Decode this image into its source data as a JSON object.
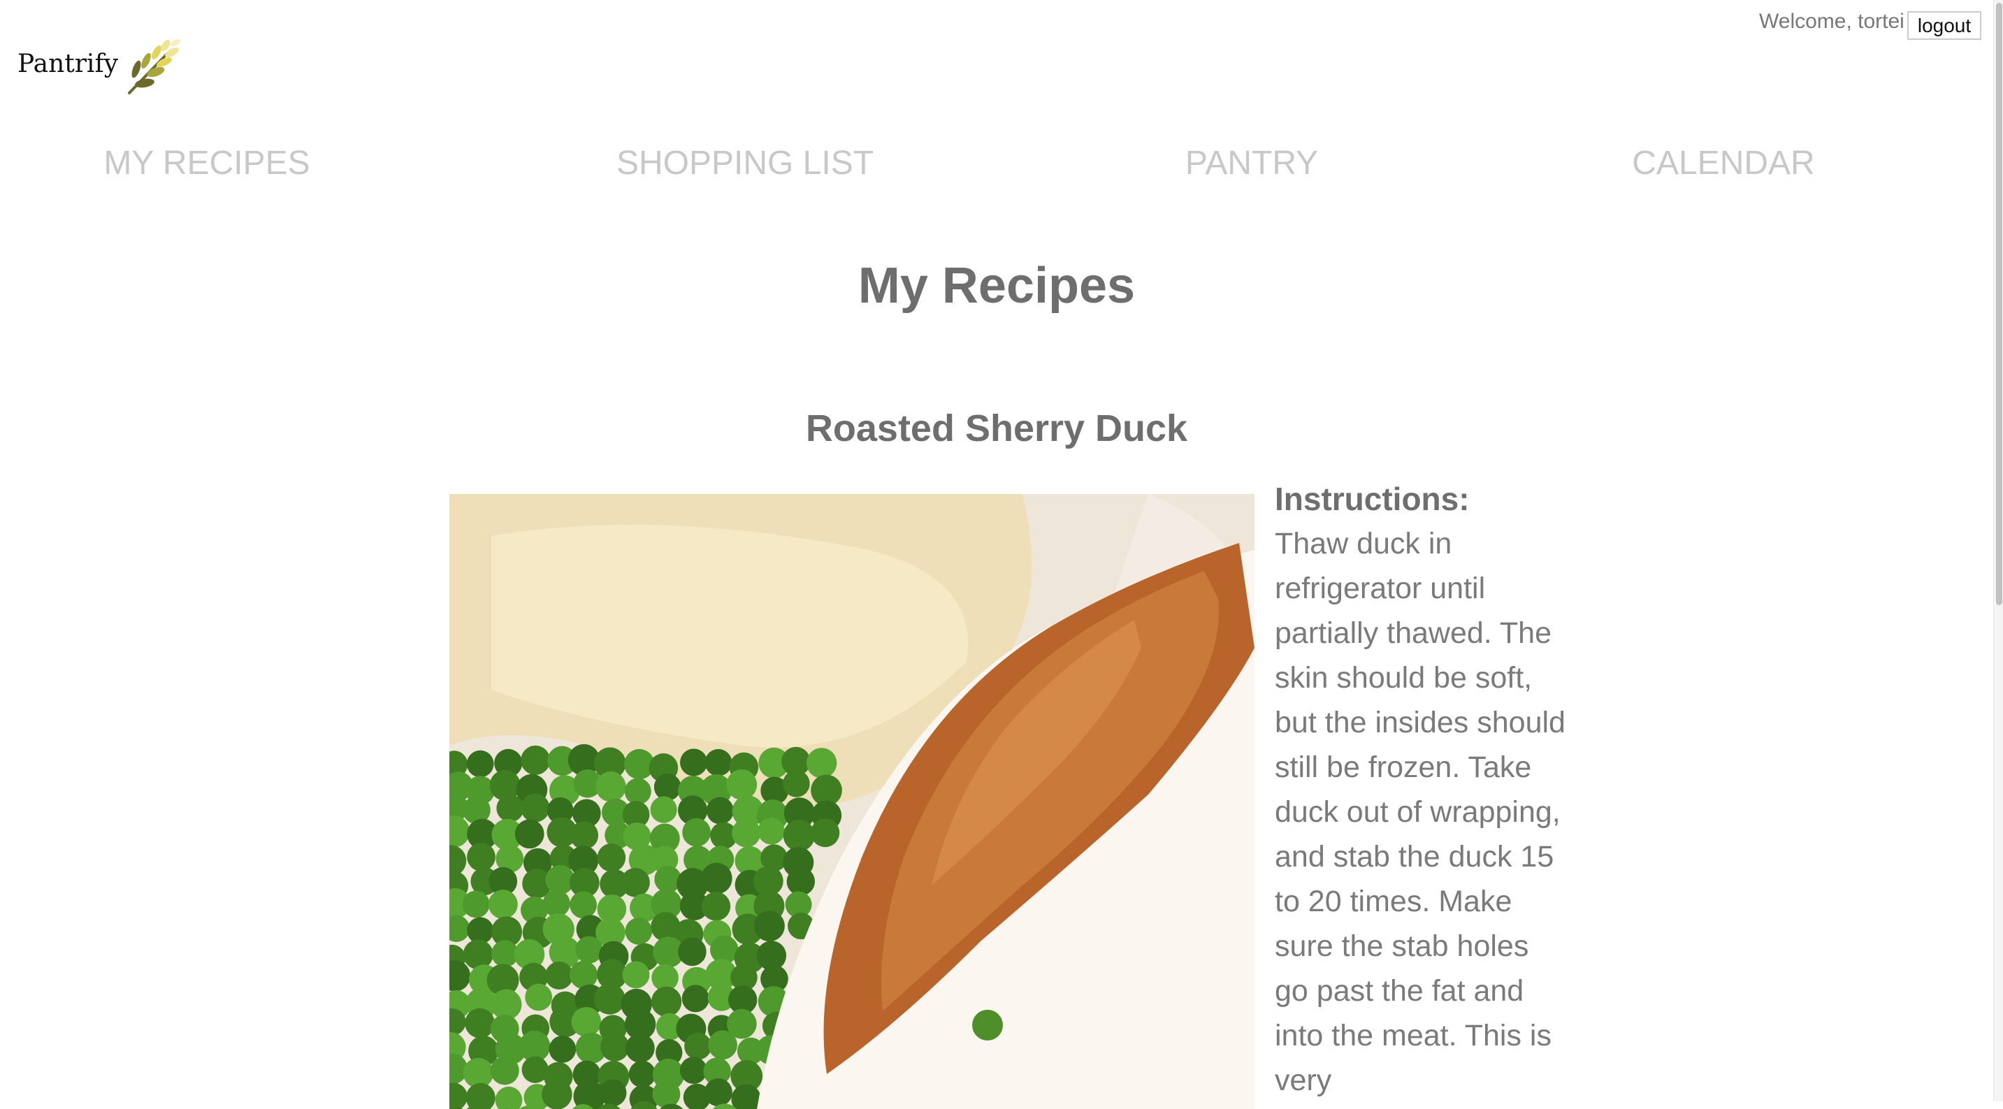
{
  "brand": {
    "name": "Pantrify",
    "logo_icon": "wheat-icon",
    "colors": [
      "#6b6a2a",
      "#a8a63c",
      "#e2d65a",
      "#f3e8a0"
    ]
  },
  "user": {
    "welcome": "Welcome, tortei",
    "logout_label": "logout"
  },
  "nav": {
    "items": [
      {
        "label": "MY RECIPES"
      },
      {
        "label": "SHOPPING LIST"
      },
      {
        "label": "PANTRY"
      },
      {
        "label": "CALENDAR"
      }
    ]
  },
  "page": {
    "title": "My Recipes"
  },
  "recipe": {
    "title": "Roasted Sherry Duck",
    "instructions_label": "Instructions:",
    "instructions": "Thaw duck in refrigerator until partially thawed. The skin should be soft, but the insides should still be frozen. Take duck out of wrapping, and stab the duck 15 to 20 times. Make sure the stab holes go past the fat and into the meat. This is very"
  },
  "colors": {
    "nav": "#c8c8c8",
    "heading": "#6e6e6e",
    "text": "#7a7a7a"
  }
}
